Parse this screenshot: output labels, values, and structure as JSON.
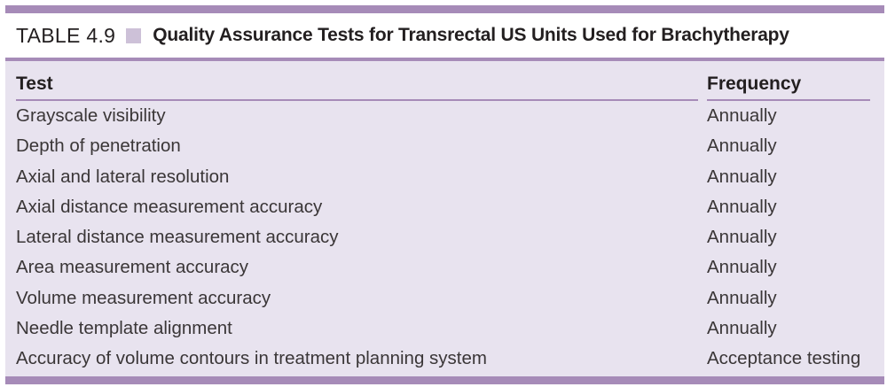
{
  "caption": {
    "label": "TABLE 4.9",
    "title": "Quality Assurance Tests for Transrectal US Units Used for Brachytherapy"
  },
  "columns": {
    "test": "Test",
    "frequency": "Frequency"
  },
  "rows": [
    {
      "test": "Grayscale visibility",
      "frequency": "Annually"
    },
    {
      "test": "Depth of penetration",
      "frequency": "Annually"
    },
    {
      "test": "Axial and lateral resolution",
      "frequency": "Annually"
    },
    {
      "test": "Axial distance measurement accuracy",
      "frequency": "Annually"
    },
    {
      "test": "Lateral distance measurement accuracy",
      "frequency": "Annually"
    },
    {
      "test": "Area measurement accuracy",
      "frequency": "Annually"
    },
    {
      "test": "Volume measurement accuracy",
      "frequency": "Annually"
    },
    {
      "test": "Needle template alignment",
      "frequency": "Annually"
    },
    {
      "test": "Accuracy of volume contours in treatment planning system",
      "frequency": "Acceptance testing"
    }
  ],
  "colors": {
    "rule": "#a68bb8",
    "body_background": "#e8e3ef",
    "caption_square": "#cdc1d8"
  }
}
